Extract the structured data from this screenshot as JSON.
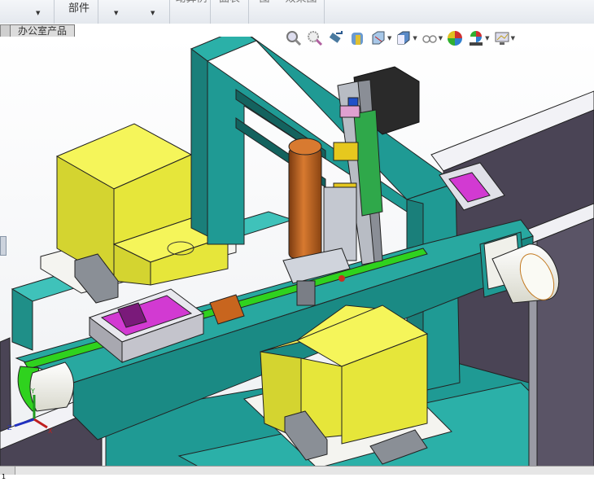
{
  "ribbon": {
    "buttons": [
      {
        "label": "部件",
        "has_dropdown": true
      },
      {
        "label": "",
        "has_dropdown": true
      },
      {
        "label": "",
        "has_dropdown": true
      }
    ],
    "partial_labels": [
      "动算例",
      "曲表",
      "图",
      "效果图"
    ]
  },
  "document_tab": {
    "label": "办公室产品"
  },
  "heads_up_toolbar": {
    "icons": [
      "zoom-to-fit-icon",
      "zoom-to-area-icon",
      "previous-view-icon",
      "section-view-icon",
      "view-orientation-icon",
      "display-style-icon",
      "hide-show-items-icon",
      "edit-appearance-icon",
      "apply-scene-icon",
      "view-settings-icon"
    ]
  },
  "model": {
    "colors": {
      "teal": "#1f9a94",
      "yellow": "#e6e63a",
      "orange": "#c8651e",
      "magenta": "#d23ad2",
      "green": "#2fd21e",
      "wall": "#4a4455"
    }
  },
  "triad": {
    "x": "X",
    "y": "Y",
    "z": "Z"
  },
  "status_bar": {
    "cell": "1"
  }
}
